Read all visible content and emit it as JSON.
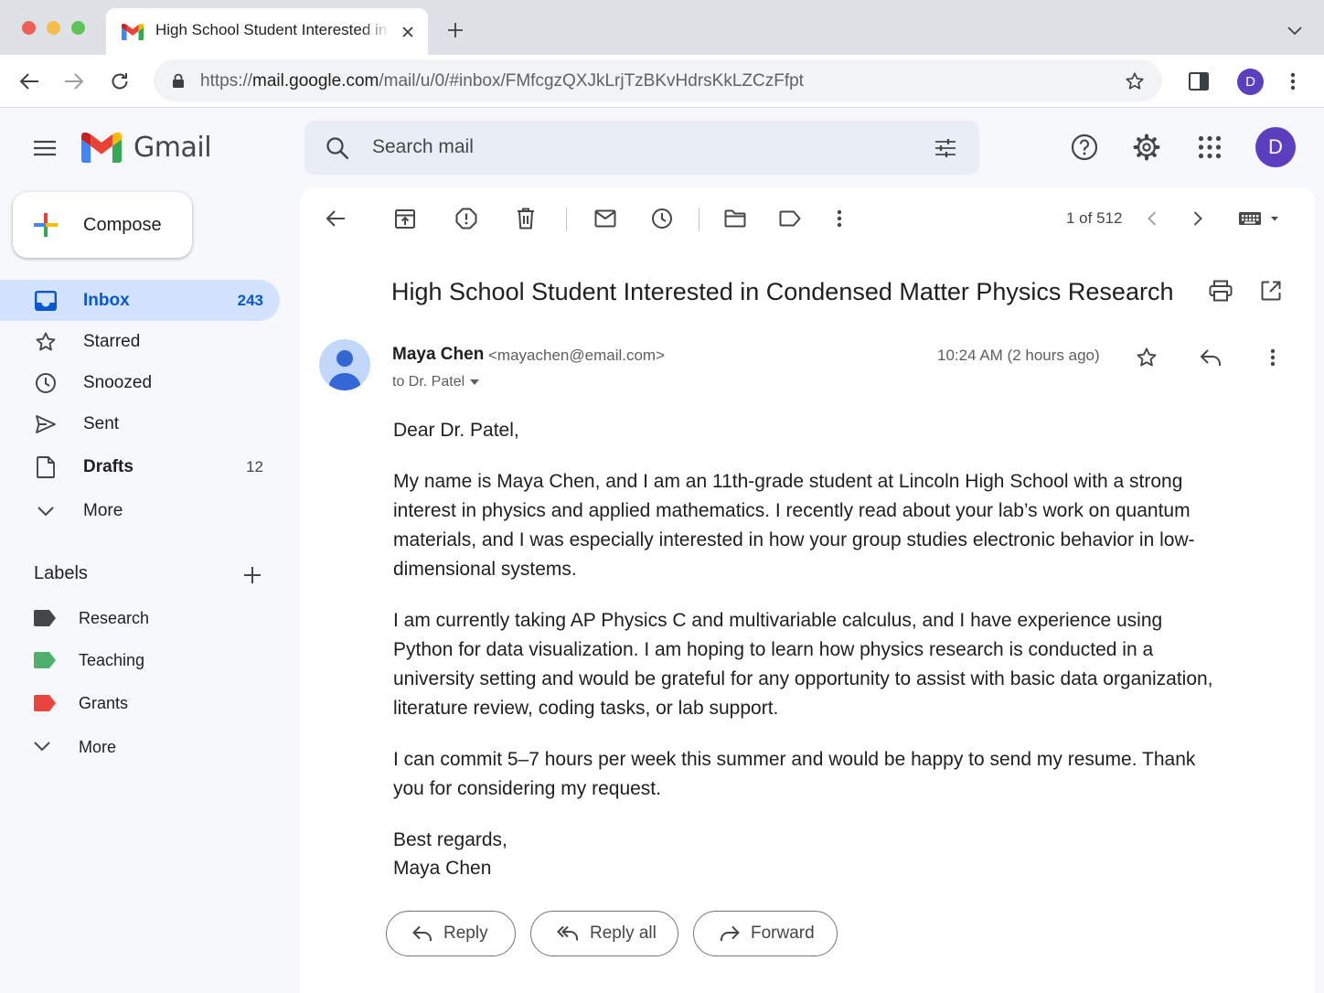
{
  "browser": {
    "tab_title": "High School Student Interested in Condensed Matter Physics Research",
    "url_scheme": "https://",
    "url_host": "mail.google.com",
    "url_path": "/mail/u/0/#inbox/FMfcgzQXJkLrjTzBKvHdrsKkLZCzFfpt",
    "profile_initial": "D"
  },
  "gmail": {
    "product_name": "Gmail",
    "search_placeholder": "Search mail",
    "account_initial": "D"
  },
  "sidebar": {
    "compose_label": "Compose",
    "nav": [
      {
        "label": "Inbox",
        "count": "243"
      },
      {
        "label": "Starred",
        "count": ""
      },
      {
        "label": "Snoozed",
        "count": ""
      },
      {
        "label": "Sent",
        "count": ""
      },
      {
        "label": "Drafts",
        "count": "12"
      },
      {
        "label": "More",
        "count": ""
      }
    ],
    "labels_heading": "Labels",
    "labels": [
      {
        "name": "Research",
        "color": "#444746"
      },
      {
        "name": "Teaching",
        "color": "#4fb06e"
      },
      {
        "name": "Grants",
        "color": "#e8453c"
      }
    ],
    "labels_more": "More"
  },
  "toolbar": {
    "pager": "1 of 512"
  },
  "email": {
    "subject": "High School Student Interested in Condensed Matter Physics Research",
    "sender_name": "Maya Chen",
    "sender_email": "<mayachen@email.com>",
    "recipient": "to Dr. Patel",
    "time": "10:24 AM (2 hours ago)",
    "greeting": "Dear Dr. Patel,",
    "paragraphs": [
      "My name is Maya Chen, and I am an 11th-grade student at Lincoln High School with a strong interest in physics and applied mathematics. I recently read about your lab’s work on quantum materials, and I was especially interested in how your group studies electronic behavior in low-dimensional systems.",
      "I am currently taking AP Physics C and multivariable calculus, and I have experience using Python for data visualization. I am hoping to learn how physics research is conducted in a university setting and would be grateful for any opportunity to assist with basic data organization, literature review, coding tasks, or lab support.",
      "I can commit 5–7 hours per week this summer and would be happy to send my resume. Thank you for considering my request."
    ],
    "closing": "Best regards,",
    "signature": "Maya Chen"
  },
  "actions": {
    "reply": "Reply",
    "reply_all": "Reply all",
    "forward": "Forward"
  },
  "colors": {
    "accent_blue": "#0b57d0",
    "active_nav_bg": "#d3e3fd",
    "avatar_purple": "#5b3fbf"
  }
}
